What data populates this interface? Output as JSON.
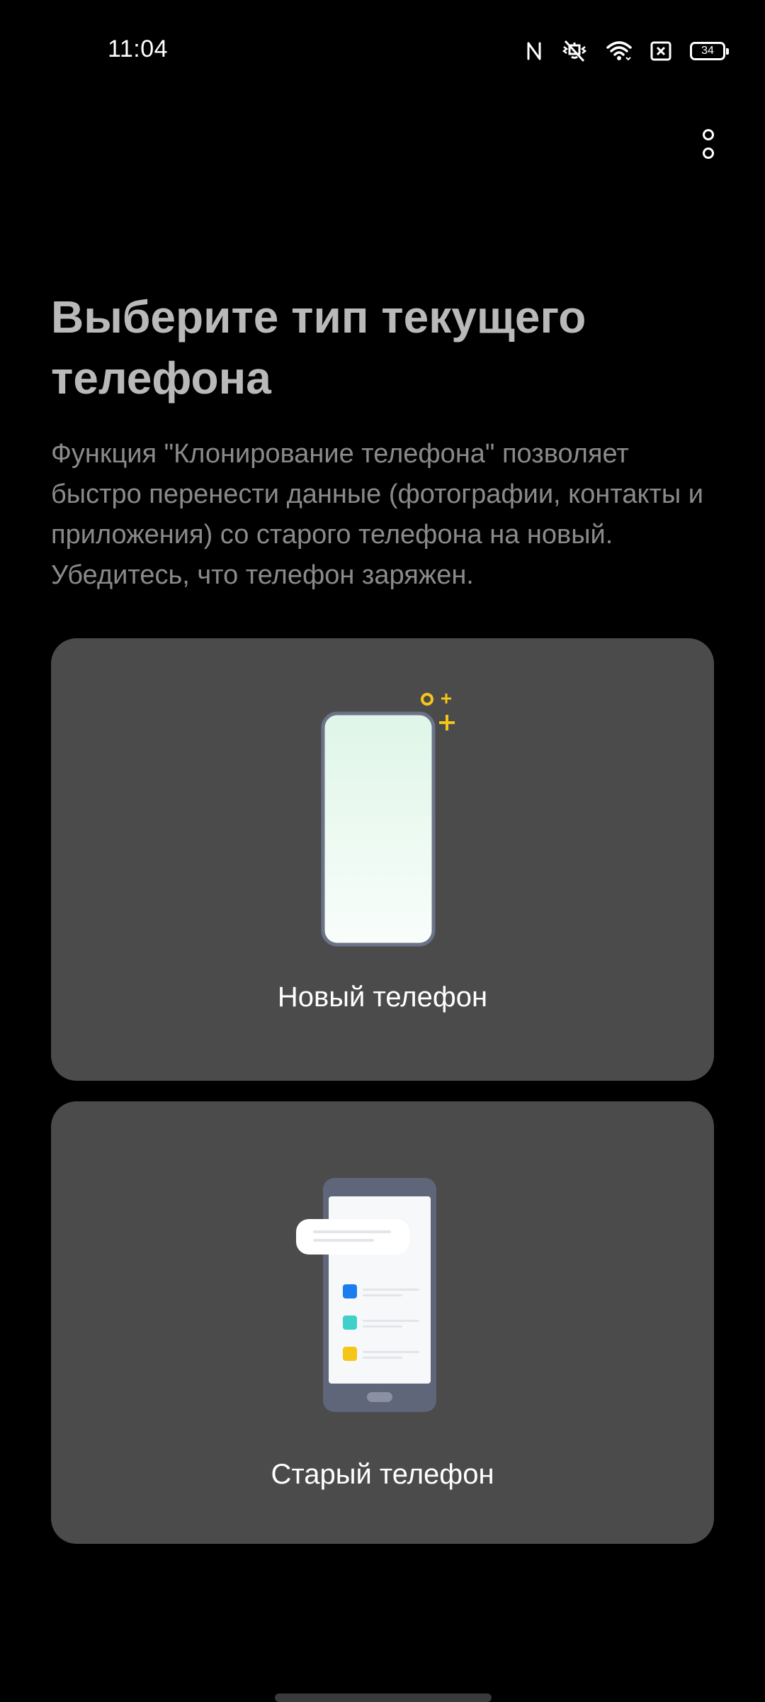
{
  "status_bar": {
    "time": "11:04",
    "icons": [
      "nfc-icon",
      "vibrate-mute-icon",
      "wifi-icon",
      "sim-off-icon",
      "battery-icon"
    ],
    "battery_level": "34"
  },
  "toolbar": {
    "more_icon": "more-vertical-icon"
  },
  "header": {
    "title": "Выберите тип текущего телефона",
    "description": "Функция \"Клонирование телефона\" позволяет быстро перенести данные (фотографии, контакты и приложения) со старого телефона на новый. Убедитесь, что телефон заряжен."
  },
  "options": {
    "new_phone": {
      "label": "Новый телефон",
      "icon": "new-phone-illustration"
    },
    "old_phone": {
      "label": "Старый телефон",
      "icon": "old-phone-illustration"
    }
  },
  "colors": {
    "background": "#000000",
    "card": "#4b4b4b",
    "accent_yellow": "#f5c518",
    "title": "#b9b9b9",
    "description": "#8a8a8a"
  }
}
